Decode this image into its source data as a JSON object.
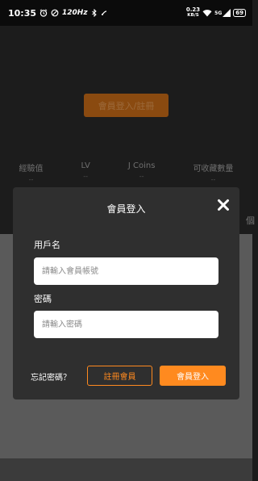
{
  "status_bar": {
    "time": "10:35",
    "refresh_rate": "120Hz",
    "net_speed_value": "0.23",
    "net_speed_unit": "KB/S",
    "signal_label": "5G",
    "battery": "69"
  },
  "background": {
    "login_register_button": "會員登入/註冊",
    "stats": [
      {
        "label": "經驗值",
        "value": "--"
      },
      {
        "label": "LV",
        "value": "--"
      },
      {
        "label": "J Coins",
        "value": "--"
      },
      {
        "label": "可收藏數量",
        "value": "--"
      }
    ],
    "side_label": "個"
  },
  "modal": {
    "title": "會員登入",
    "username_label": "用戶名",
    "username_placeholder": "請輸入會員帳號",
    "username_value": "",
    "password_label": "密碼",
    "password_placeholder": "請輸入密碼",
    "password_value": "",
    "forgot_password": "忘記密碼？",
    "register_button": "註冊會員",
    "login_button": "會員登入"
  },
  "colors": {
    "accent": "#ff8a1f",
    "modal_bg": "#2f2f2f",
    "overlay": "#5a5a5a"
  }
}
